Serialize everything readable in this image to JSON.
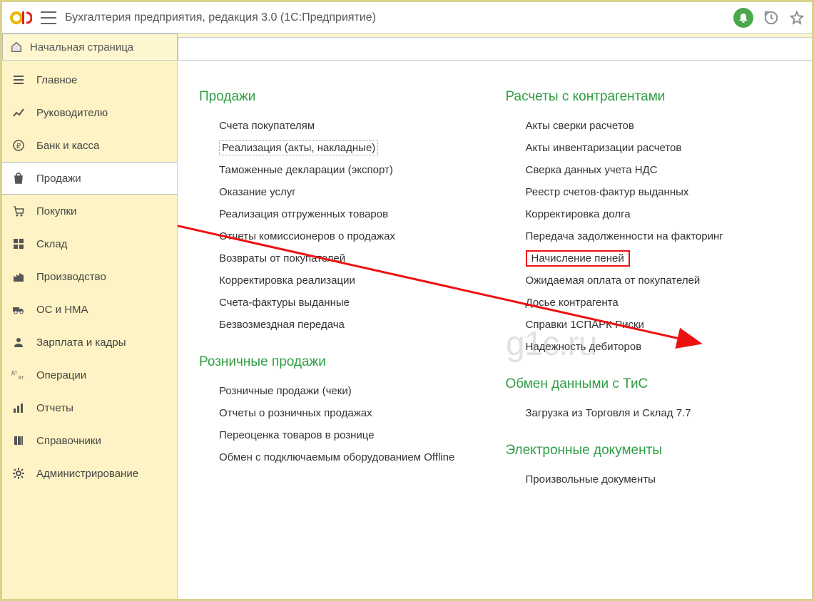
{
  "header": {
    "title": "Бухгалтерия предприятия, редакция 3.0  (1С:Предприятие)"
  },
  "tabs": {
    "start_label": "Начальная страница"
  },
  "sidebar": {
    "items": [
      {
        "label": "Главное",
        "icon": "list"
      },
      {
        "label": "Руководителю",
        "icon": "chart"
      },
      {
        "label": "Банк и касса",
        "icon": "ruble"
      },
      {
        "label": "Продажи",
        "icon": "bag",
        "active": true
      },
      {
        "label": "Покупки",
        "icon": "cart"
      },
      {
        "label": "Склад",
        "icon": "grid"
      },
      {
        "label": "Производство",
        "icon": "factory"
      },
      {
        "label": "ОС и НМА",
        "icon": "truck"
      },
      {
        "label": "Зарплата и кадры",
        "icon": "person"
      },
      {
        "label": "Операции",
        "icon": "dtkt"
      },
      {
        "label": "Отчеты",
        "icon": "bars"
      },
      {
        "label": "Справочники",
        "icon": "books"
      },
      {
        "label": "Администрирование",
        "icon": "gear"
      }
    ]
  },
  "content": {
    "left": [
      {
        "title": "Продажи",
        "items": [
          "Счета покупателям",
          "Реализация (акты, накладные)",
          "Таможенные декларации (экспорт)",
          "Оказание услуг",
          "Реализация отгруженных товаров",
          "Отчеты комиссионеров о продажах",
          "Возвраты от покупателей",
          "Корректировка реализации",
          "Счета-фактуры выданные",
          "Безвозмездная передача"
        ],
        "outlined_index": 1
      },
      {
        "title": "Розничные продажи",
        "items": [
          "Розничные продажи (чеки)",
          "Отчеты о розничных продажах",
          "Переоценка товаров в рознице",
          "Обмен с подключаемым оборудованием Offline"
        ]
      }
    ],
    "right": [
      {
        "title": "Расчеты с контрагентами",
        "items": [
          "Акты сверки расчетов",
          "Акты инвентаризации расчетов",
          "Сверка данных учета НДС",
          "Реестр счетов-фактур выданных",
          "Корректировка долга",
          "Передача задолженности на факторинг",
          "Начисление пеней",
          "Ожидаемая оплата от покупателей",
          "Досье контрагента",
          "Справки 1СПАРК Риски",
          "Надежность дебиторов"
        ],
        "highlighted_index": 6
      },
      {
        "title": "Обмен данными с ТиС",
        "items": [
          "Загрузка из Торговля и Склад 7.7"
        ]
      },
      {
        "title": "Электронные документы",
        "items": [
          "Произвольные документы"
        ]
      }
    ]
  },
  "watermark": "g1c.ru"
}
